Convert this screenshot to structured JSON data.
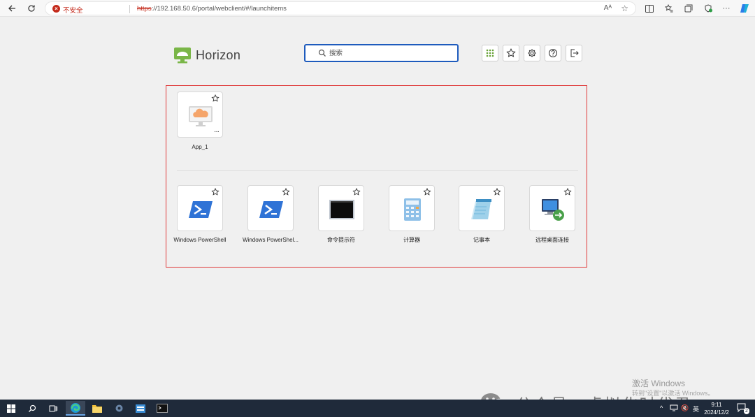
{
  "browser": {
    "security_label": "不安全",
    "url_scheme": "https",
    "url_rest": "://192.168.50.6/portal/webclient/#/launchitems",
    "read_aloud": "Aᴬ"
  },
  "header": {
    "brand": "Horizon",
    "search_placeholder": "搜索",
    "buttons": [
      "apps-grid-icon",
      "favorites-icon",
      "settings-icon",
      "help-icon",
      "logout-icon"
    ]
  },
  "desktops": [
    {
      "label": "App_1",
      "icon": "cloud-monitor-icon"
    }
  ],
  "apps": [
    {
      "label": "Windows PowerShell",
      "icon": "powershell-icon"
    },
    {
      "label": "Windows PowerShel...",
      "icon": "powershell-icon"
    },
    {
      "label": "命令提示符",
      "icon": "cmd-icon"
    },
    {
      "label": "计算器",
      "icon": "calculator-icon"
    },
    {
      "label": "记事本",
      "icon": "notepad-icon"
    },
    {
      "label": "远程桌面连接",
      "icon": "remote-desktop-icon"
    }
  ],
  "watermark": {
    "activate_title": "激活 Windows",
    "activate_sub": "转到\"设置\"以激活 Windows。",
    "wechat": "公众号 · 虚拟化时代君"
  },
  "taskbar": {
    "ime": "英",
    "time": "9:11",
    "date": "2024/12/2",
    "notifications": "2"
  },
  "colors": {
    "brand_green": "#7ab648",
    "accent_blue": "#1e5bbd",
    "highlight_red": "#e03a3a"
  }
}
